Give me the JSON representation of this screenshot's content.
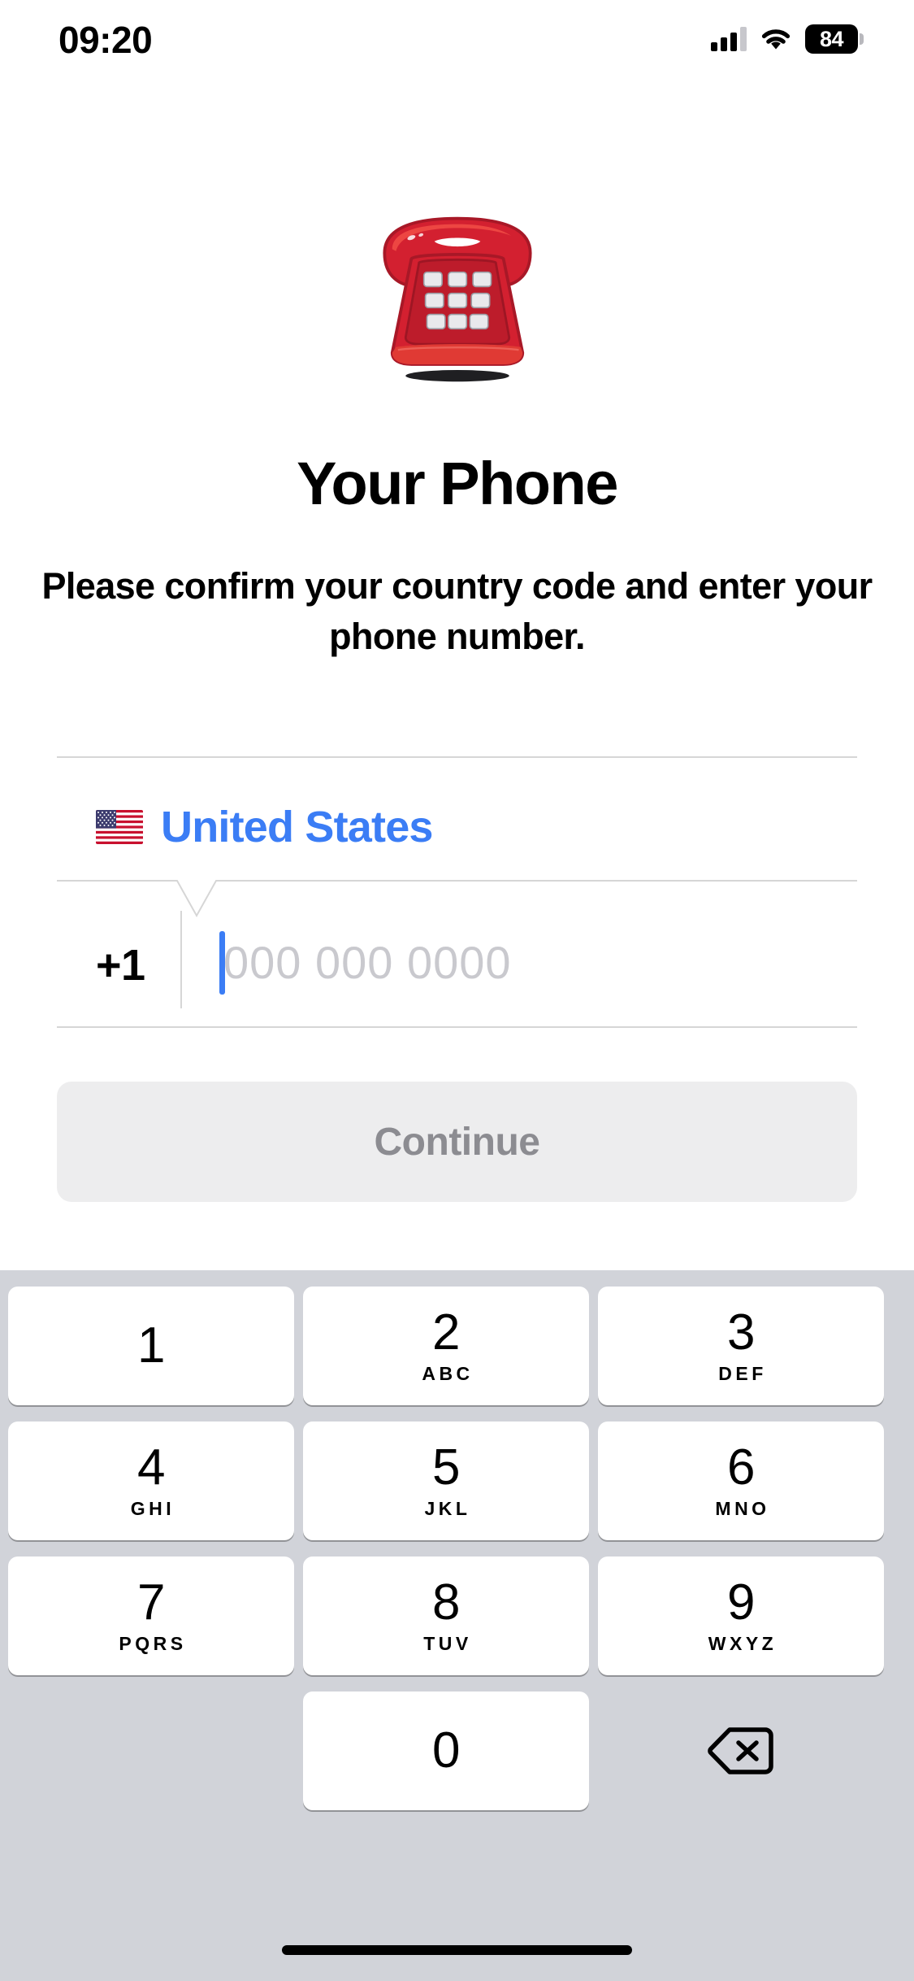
{
  "status_bar": {
    "time": "09:20",
    "cellular_icon": "cellular-bars-icon",
    "cellular_bars_active": 3,
    "cellular_bars_total": 4,
    "wifi_icon": "wifi-icon",
    "battery_icon": "battery-icon",
    "battery_level": "84"
  },
  "hero": {
    "icon": "telephone-emoji",
    "emoji": "☎️",
    "title": "Your Phone",
    "subtitle": "Please confirm your country code and enter your phone number."
  },
  "form": {
    "country": {
      "flag_icon": "united-states-flag-icon",
      "flag_emoji": "🇺🇸",
      "name": "United States",
      "accent_color": "#3b7df5"
    },
    "phone": {
      "country_code": "+1",
      "value": "",
      "placeholder": "000 000 0000",
      "caret_color": "#3b7df5",
      "placeholder_color": "#c9c9ce"
    },
    "divider_color": "#d6d6d6"
  },
  "continue_button": {
    "label": "Continue",
    "enabled": false,
    "background_color": "#ededee",
    "text_color": "#8c8c91"
  },
  "keypad": {
    "background_color": "#d1d3d9",
    "keys": [
      {
        "digit": "1",
        "letters": ""
      },
      {
        "digit": "2",
        "letters": "ABC"
      },
      {
        "digit": "3",
        "letters": "DEF"
      },
      {
        "digit": "4",
        "letters": "GHI"
      },
      {
        "digit": "5",
        "letters": "JKL"
      },
      {
        "digit": "6",
        "letters": "MNO"
      },
      {
        "digit": "7",
        "letters": "PQRS"
      },
      {
        "digit": "8",
        "letters": "TUV"
      },
      {
        "digit": "9",
        "letters": "WXYZ"
      },
      {
        "digit": "0",
        "letters": ""
      }
    ],
    "delete_key_icon": "backspace-delete-icon"
  },
  "home_indicator": "home-indicator"
}
